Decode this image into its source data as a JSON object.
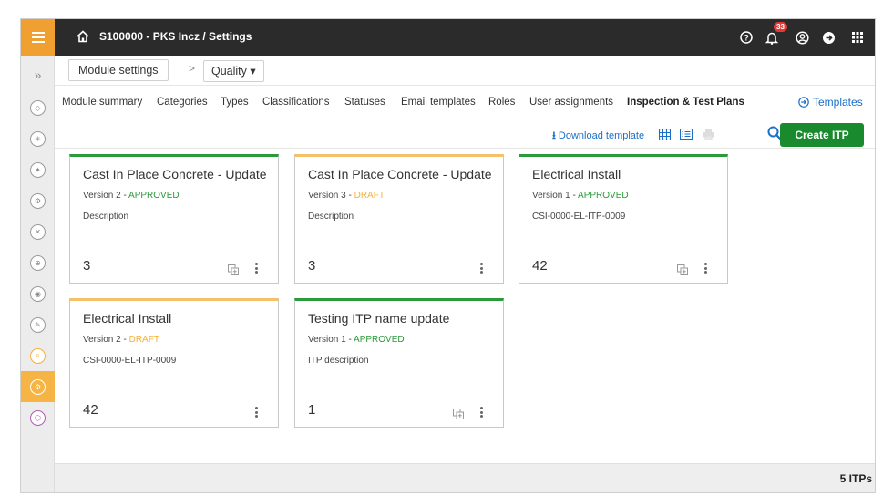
{
  "topbar": {
    "breadcrumb": "S100000 - PKS Incz  /  Settings",
    "notification_count": "33",
    "icons": [
      "menu-icon",
      "home-icon",
      "help-icon",
      "bell-icon",
      "user-icon",
      "logout-icon",
      "apps-grid-icon"
    ]
  },
  "subheader": {
    "module_settings": "Module settings",
    "module_selector": "Quality ▾"
  },
  "tabs": [
    "Module summary",
    "Categories",
    "Types",
    "Classifications",
    "Statuses",
    "Email templates",
    "Roles",
    "User assignments",
    "Inspection & Test Plans"
  ],
  "active_tab": "Inspection & Test Plans",
  "templates_link": "Templates",
  "toolbar": {
    "download_template": "Download template",
    "create_button": "Create ITP"
  },
  "cards": [
    {
      "title": "Cast In Place Concrete - Update",
      "version": "Version 2 - ",
      "status": "APPROVED",
      "description": "Description",
      "count": "3",
      "has_copy": true
    },
    {
      "title": "Cast In Place Concrete - Update",
      "version": "Version 3 - ",
      "status": "DRAFT",
      "description": "Description",
      "count": "3",
      "has_copy": false
    },
    {
      "title": "Electrical Install",
      "version": "Version 1 - ",
      "status": "APPROVED",
      "description": "CSI-0000-EL-ITP-0009",
      "count": "42",
      "has_copy": true
    },
    {
      "title": "Electrical Install",
      "version": "Version 2 - ",
      "status": "DRAFT",
      "description": "CSI-0000-EL-ITP-0009",
      "count": "42",
      "has_copy": false
    },
    {
      "title": "Testing ITP name update",
      "version": "Version 1 - ",
      "status": "APPROVED",
      "description": "ITP description",
      "count": "1",
      "has_copy": true
    }
  ],
  "footer": {
    "total": "5 ITPs"
  },
  "colors": {
    "approved": "#2a9a3a",
    "draft": "#f5b03a",
    "accent": "#f0a030",
    "link": "#1a6fc9",
    "primary_button": "#1a8a2e"
  }
}
